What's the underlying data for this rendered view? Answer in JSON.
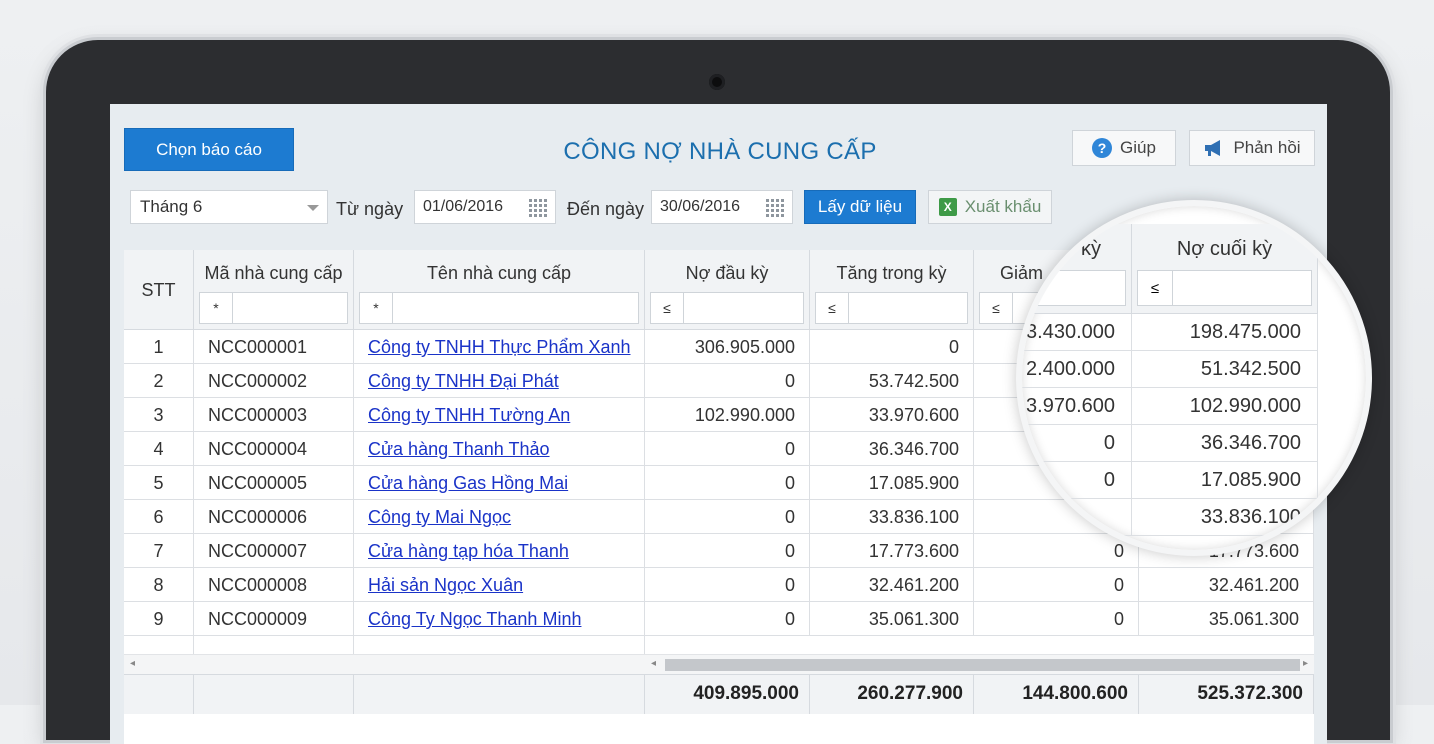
{
  "toolbar": {
    "report_button": "Chọn báo cáo",
    "title": "CÔNG NỢ NHÀ CUNG CẤP",
    "help": "Giúp",
    "feedback": "Phản hồi"
  },
  "filters": {
    "month": "Tháng 6",
    "from_label": "Từ ngày",
    "from_date": "01/06/2016",
    "to_label": "Đến ngày",
    "to_date": "30/06/2016",
    "fetch_button": "Lấy dữ liệu",
    "export_button": "Xuất khẩu"
  },
  "columns": {
    "stt": "STT",
    "code": "Mã nhà cung cấp",
    "name": "Tên nhà cung cấp",
    "opening": "Nợ đầu kỳ",
    "increase": "Tăng trong kỳ",
    "decrease": "Giảm",
    "closing": "Nợ cuối kỳ",
    "magnifier_decrease": "kỳ"
  },
  "column_filters": {
    "code_op": "*",
    "name_op": "*",
    "opening_op": "≤",
    "increase_op": "≤",
    "decrease_op": "≤",
    "closing_op": "≤"
  },
  "rows": [
    {
      "stt": "1",
      "code": "NCC000001",
      "name": "Công ty TNHH Thực Phẩm Xanh",
      "opening": "306.905.000",
      "increase": "0",
      "decrease": "",
      "closing": ""
    },
    {
      "stt": "2",
      "code": "NCC000002",
      "name": "Công ty TNHH Đại Phát",
      "opening": "0",
      "increase": "53.742.500",
      "decrease": "",
      "closing": ""
    },
    {
      "stt": "3",
      "code": "NCC000003",
      "name": "Công ty TNHH Tường An",
      "opening": "102.990.000",
      "increase": "33.970.600",
      "decrease": "",
      "closing": ""
    },
    {
      "stt": "4",
      "code": "NCC000004",
      "name": "Cửa hàng Thanh Thảo",
      "opening": "0",
      "increase": "36.346.700",
      "decrease": "",
      "closing": ""
    },
    {
      "stt": "5",
      "code": "NCC000005",
      "name": "Cửa hàng Gas Hồng Mai",
      "opening": "0",
      "increase": "17.085.900",
      "decrease": "",
      "closing": ""
    },
    {
      "stt": "6",
      "code": "NCC000006",
      "name": "Công ty Mai Ngọc",
      "opening": "0",
      "increase": "33.836.100",
      "decrease": "",
      "closing": ""
    },
    {
      "stt": "7",
      "code": "NCC000007",
      "name": "Cửa hàng tạp hóa Thanh",
      "opening": "0",
      "increase": "17.773.600",
      "decrease": "0",
      "closing": "17.773.600"
    },
    {
      "stt": "8",
      "code": "NCC000008",
      "name": "Hải sản Ngọc Xuân",
      "opening": "0",
      "increase": "32.461.200",
      "decrease": "0",
      "closing": "32.461.200"
    },
    {
      "stt": "9",
      "code": "NCC000009",
      "name": "Công Ty Ngọc Thanh Minh",
      "opening": "0",
      "increase": "35.061.300",
      "decrease": "0",
      "closing": "35.061.300"
    }
  ],
  "magnifier_rows": [
    {
      "decrease": "3.430.000",
      "closing": "198.475.000"
    },
    {
      "decrease": "2.400.000",
      "closing": "51.342.500"
    },
    {
      "decrease": "3.970.600",
      "closing": "102.990.000"
    },
    {
      "decrease": "0",
      "closing": "36.346.700"
    },
    {
      "decrease": "0",
      "closing": "17.085.900"
    },
    {
      "decrease": "",
      "closing": "33.836.100"
    }
  ],
  "totals": {
    "opening": "409.895.000",
    "increase": "260.277.900",
    "decrease": "144.800.600",
    "closing": "525.372.300"
  },
  "icons": {
    "help": "question-icon",
    "feedback": "megaphone-icon",
    "export": "excel-icon",
    "calendar": "calendar-icon",
    "dropdown": "chevron-down-icon"
  },
  "colors": {
    "primary": "#1d7bd1",
    "title": "#1c6fae",
    "link": "#1a33c8"
  }
}
